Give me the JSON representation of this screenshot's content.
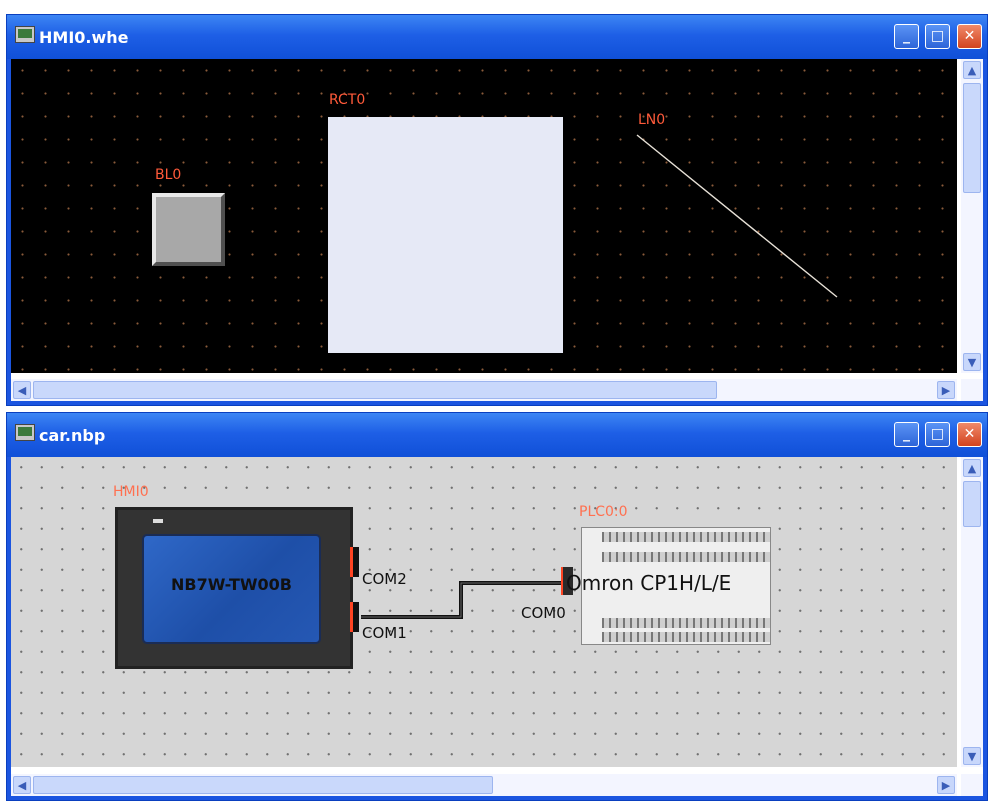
{
  "windows": [
    {
      "title": "HMI0.whe",
      "canvas": {
        "background_color": "#000000",
        "label_color": "#ff5a3a",
        "objects": {
          "bl0_label": "BL0",
          "rct0_label": "RCT0",
          "ln0_label": "LN0"
        }
      }
    },
    {
      "title": "car.nbp",
      "canvas": {
        "background_color": "#d6d6d6",
        "hmi_label": "HMI0",
        "hmi_model": "NB7W-TW00B",
        "hmi_ports": [
          "COM2",
          "COM1"
        ],
        "plc_label": "PLC0:0",
        "plc_model": "Omron CP1H/L/E",
        "plc_port": "COM0"
      }
    }
  ],
  "window_controls": {
    "minimize": "_",
    "maximize": "□",
    "close": "✕"
  },
  "scroll_arrows": {
    "up": "▲",
    "down": "▼",
    "left": "◀",
    "right": "▶"
  },
  "colors": {
    "titlebar": "#1e5fe6",
    "close_button": "#d2431f",
    "scrollbar": "#c9d8fb"
  }
}
